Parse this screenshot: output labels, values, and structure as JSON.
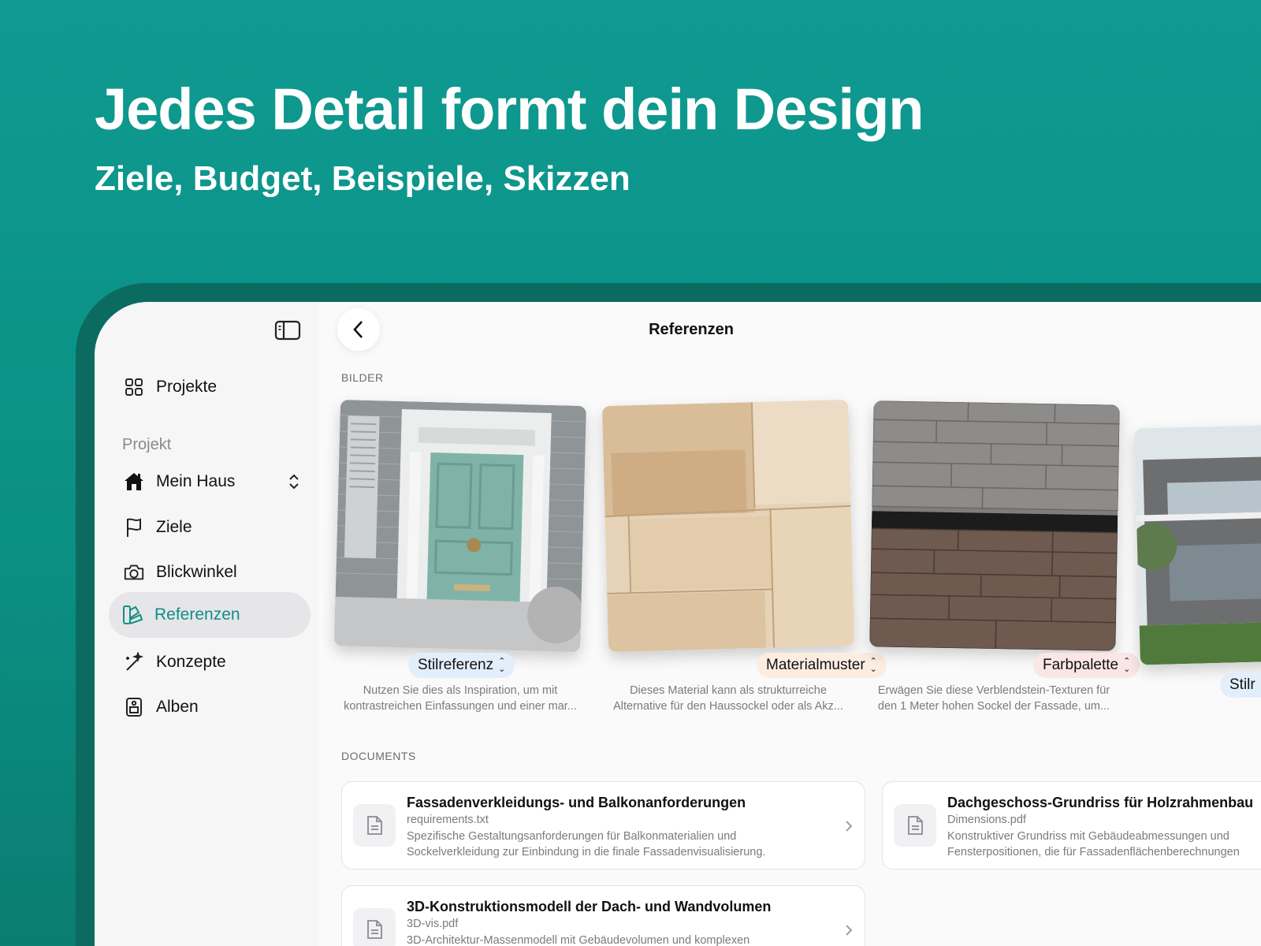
{
  "hero": {
    "title": "Jedes Detail formt dein Design",
    "subtitle": "Ziele, Budget, Beispiele, Skizzen"
  },
  "sidebar": {
    "projects_label": "Projekte",
    "section_label": "Projekt",
    "project_selector": "Mein Haus",
    "items": [
      {
        "label": "Ziele",
        "icon": "flag-icon"
      },
      {
        "label": "Blickwinkel",
        "icon": "camera-icon"
      },
      {
        "label": "Referenzen",
        "icon": "swatches-icon",
        "active": true
      },
      {
        "label": "Konzepte",
        "icon": "magic-wand-icon"
      },
      {
        "label": "Alben",
        "icon": "album-icon"
      }
    ]
  },
  "header": {
    "title": "Referenzen"
  },
  "images_section": {
    "label": "BILDER",
    "cards": [
      {
        "tag": "Stilreferenz",
        "tag_color": "#e3eefb",
        "line1": "Nutzen Sie dies als Inspiration, um mit",
        "line2": "kontrastreichen Einfassungen und einer mar..."
      },
      {
        "tag": "Materialmuster",
        "tag_color": "#fbeee1",
        "line1": "Dieses Material kann als strukturreiche",
        "line2": "Alternative für den Haussockel oder als Akz..."
      },
      {
        "tag": "Farbpalette",
        "tag_color": "#fbe6e6",
        "line1": "Erwägen Sie diese Verblendstein-Texturen für",
        "line2": "den 1 Meter hohen Sockel der Fassade, um..."
      },
      {
        "tag": "Stilr",
        "tag_color": "#e3eefb"
      }
    ]
  },
  "documents_section": {
    "label": "DOCUMENTS",
    "docs": [
      {
        "title": "Fassadenverkleidungs- und Balkonanforderungen",
        "file": "requirements.txt",
        "line1": "Spezifische Gestaltungsanforderungen für Balkonmaterialien und",
        "line2": "Sockelverkleidung zur Einbindung in die finale Fassadenvisualisierung."
      },
      {
        "title": "Dachgeschoss-Grundriss für Holzrahmenbau",
        "file": "Dimensions.pdf",
        "line1": "Konstruktiver Grundriss mit Gebäudeabmessungen und",
        "line2": "Fensterpositionen, die für Fassadenflächenberechnungen"
      },
      {
        "title": "3D-Konstruktionsmodell der Dach- und Wandvolumen",
        "file": "3D-vis.pdf",
        "line1": "3D-Architektur-Massenmodell mit Gebäudevolumen und komplexen",
        "line2": ""
      }
    ]
  }
}
